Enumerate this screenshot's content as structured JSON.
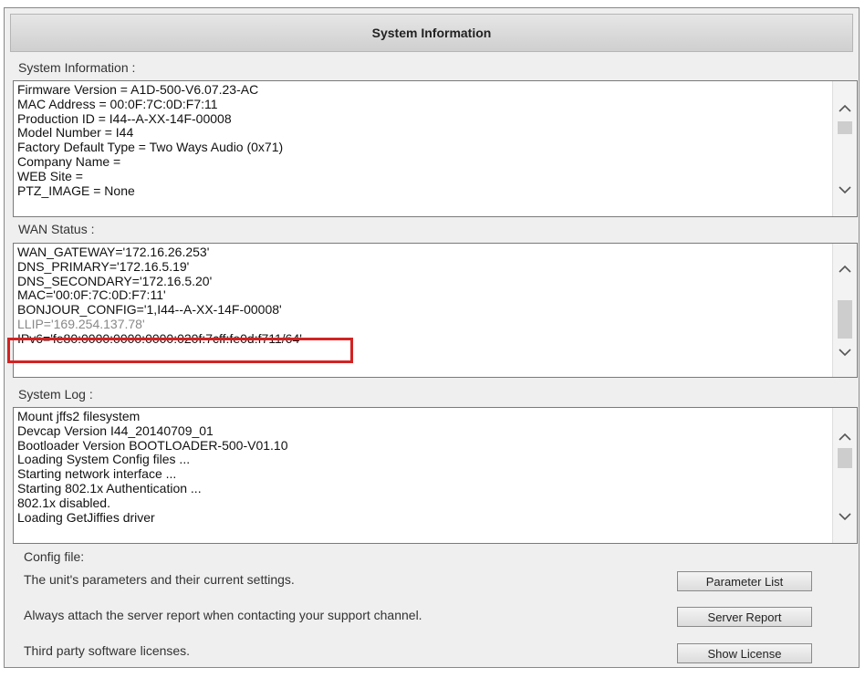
{
  "header": {
    "title": "System Information"
  },
  "system_info": {
    "label": "System Information :",
    "lines": [
      "Firmware Version = A1D-500-V6.07.23-AC",
      "MAC Address = 00:0F:7C:0D:F7:11",
      "Production ID = I44--A-XX-14F-00008",
      "Model Number = I44",
      "Factory Default Type = Two Ways Audio (0x71)",
      "Company Name =",
      "WEB Site =",
      "PTZ_IMAGE = None"
    ]
  },
  "wan_status": {
    "label": "WAN Status :",
    "lines": [
      "WAN_GATEWAY='172.16.26.253'",
      "DNS_PRIMARY='172.16.5.19'",
      "DNS_SECONDARY='172.16.5.20'",
      "MAC='00:0F:7C:0D:F7:11'",
      "BONJOUR_CONFIG='1,I44--A-XX-14F-00008'",
      "LLIP='169.254.137.78'",
      "IPv6='fe80:0000:0000:0000:020f:7cff:fe0d:f711/64'"
    ]
  },
  "system_log": {
    "label": "System Log :",
    "lines": [
      "Mount jffs2 filesystem",
      "Devcap Version I44_20140709_01",
      "Bootloader Version BOOTLOADER-500-V01.10",
      "Loading System Config files ...",
      "Starting network interface ...",
      "Starting 802.1x Authentication ...",
      "802.1x disabled.",
      "Loading GetJiffies driver"
    ]
  },
  "config": {
    "label": "Config file:",
    "rows": [
      {
        "text": "The unit's parameters and their current settings.",
        "button": "Parameter List"
      },
      {
        "text": "Always attach the server report when contacting your support channel.",
        "button": "Server Report"
      },
      {
        "text": "Third party software licenses.",
        "button": "Show License"
      }
    ]
  },
  "colors": {
    "highlight": "#d32222",
    "panel_background": "#efefef"
  }
}
